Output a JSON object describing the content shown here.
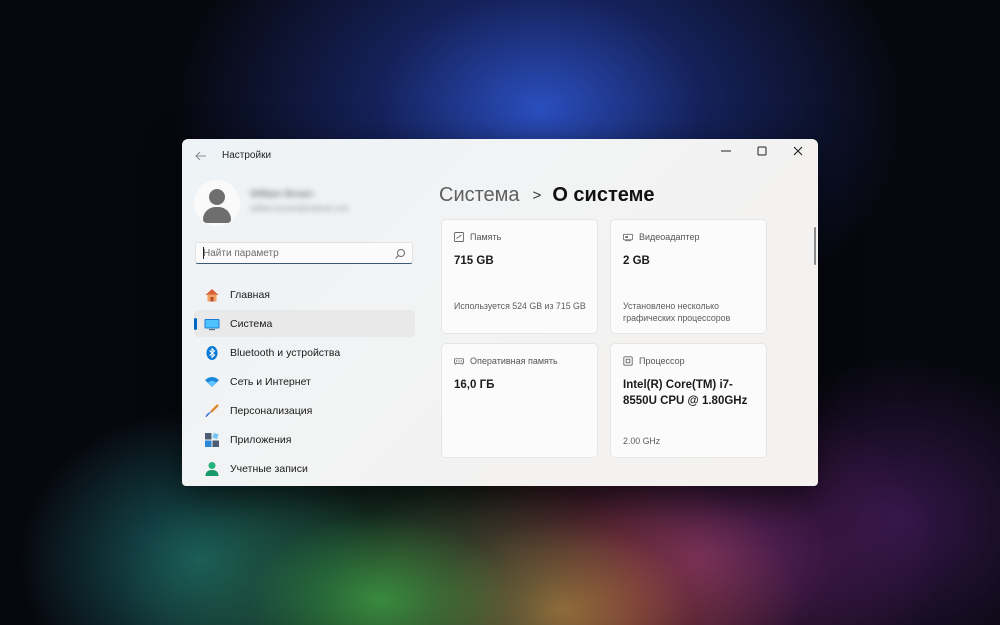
{
  "window": {
    "app_title": "Настройки",
    "controls": {
      "minimize": "minimize-icon",
      "maximize": "maximize-icon",
      "close": "close-icon"
    }
  },
  "user": {
    "name": "William Brown",
    "email": "william.brown@outlook.com"
  },
  "search": {
    "placeholder": "Найти параметр",
    "value": ""
  },
  "sidebar": {
    "items": [
      {
        "label": "Главная",
        "icon": "home-icon",
        "active": false
      },
      {
        "label": "Система",
        "icon": "monitor-icon",
        "active": true
      },
      {
        "label": "Bluetooth и устройства",
        "icon": "bluetooth-icon",
        "active": false
      },
      {
        "label": "Сеть и Интернет",
        "icon": "wifi-icon",
        "active": false
      },
      {
        "label": "Персонализация",
        "icon": "brush-icon",
        "active": false
      },
      {
        "label": "Приложения",
        "icon": "apps-icon",
        "active": false
      },
      {
        "label": "Учетные записи",
        "icon": "account-icon",
        "active": false
      }
    ]
  },
  "breadcrumb": {
    "parent": "Система",
    "separator": ">",
    "current": "О системе"
  },
  "cards": {
    "storage": {
      "title": "Память",
      "value": "715 GB",
      "desc": "Используется 524 GB из 715 GB",
      "icon": "storage-icon"
    },
    "gpu": {
      "title": "Видеоадаптер",
      "value": "2 GB",
      "desc": "Установлено несколько графических процессоров",
      "icon": "gpu-icon"
    },
    "ram": {
      "title": "Оперативная память",
      "value": "16,0 ГБ",
      "icon": "ram-icon"
    },
    "cpu": {
      "title": "Процессор",
      "value": "Intel(R) Core(TM) i7-8550U CPU @ 1.80GHz",
      "desc": "2.00 GHz",
      "icon": "cpu-icon"
    }
  },
  "colors": {
    "accent": "#0067c0",
    "background": "#07080f",
    "window": "#f2f3f3"
  }
}
